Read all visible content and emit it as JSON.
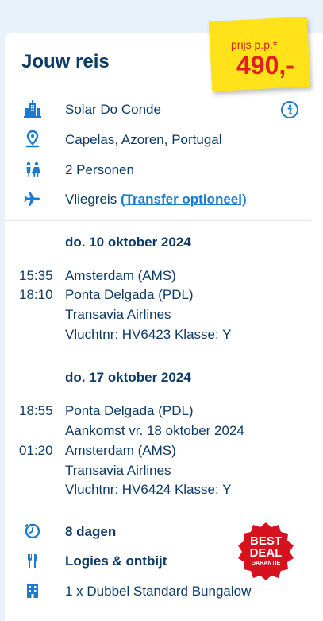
{
  "trip": {
    "title": "Jouw reis",
    "price": {
      "label": "prijs p.p.*",
      "value": "490,-"
    },
    "hotel": "Solar Do Conde",
    "location": "Capelas, Azoren, Portugal",
    "persons": "2 Personen",
    "transport": {
      "text": "Vliegreis",
      "link": "(Transfer optioneel)"
    }
  },
  "outbound": {
    "date": "do. 10 oktober 2024",
    "dep_time": "15:35",
    "dep_airport": "Amsterdam (AMS)",
    "arr_time": "18:10",
    "arr_airport": "Ponta Delgada (PDL)",
    "airline": "Transavia Airlines",
    "flight_info": "Vluchtnr: HV6423 Klasse: Y"
  },
  "return": {
    "date": "do. 17 oktober 2024",
    "dep_time": "18:55",
    "dep_airport": "Ponta Delgada (PDL)",
    "arrival_note": "Aankomst vr. 18 oktober 2024",
    "arr_time": "01:20",
    "arr_airport": "Amsterdam (AMS)",
    "airline": "Transavia Airlines",
    "flight_info": "Vluchtnr: HV6424 Klasse: Y"
  },
  "stay": {
    "duration": "8 dagen",
    "board": "Logies & ontbijt",
    "room": "1 x Dubbel Standard Bungalow"
  },
  "badge": {
    "line1": "BEST",
    "line2": "DEAL",
    "line3": "GARANTIE"
  },
  "colors": {
    "primary": "#0b3a66",
    "accent": "#1a7bd0",
    "price_bg": "#ffe21a",
    "price_text": "#e0201c",
    "badge": "#d6121e"
  }
}
